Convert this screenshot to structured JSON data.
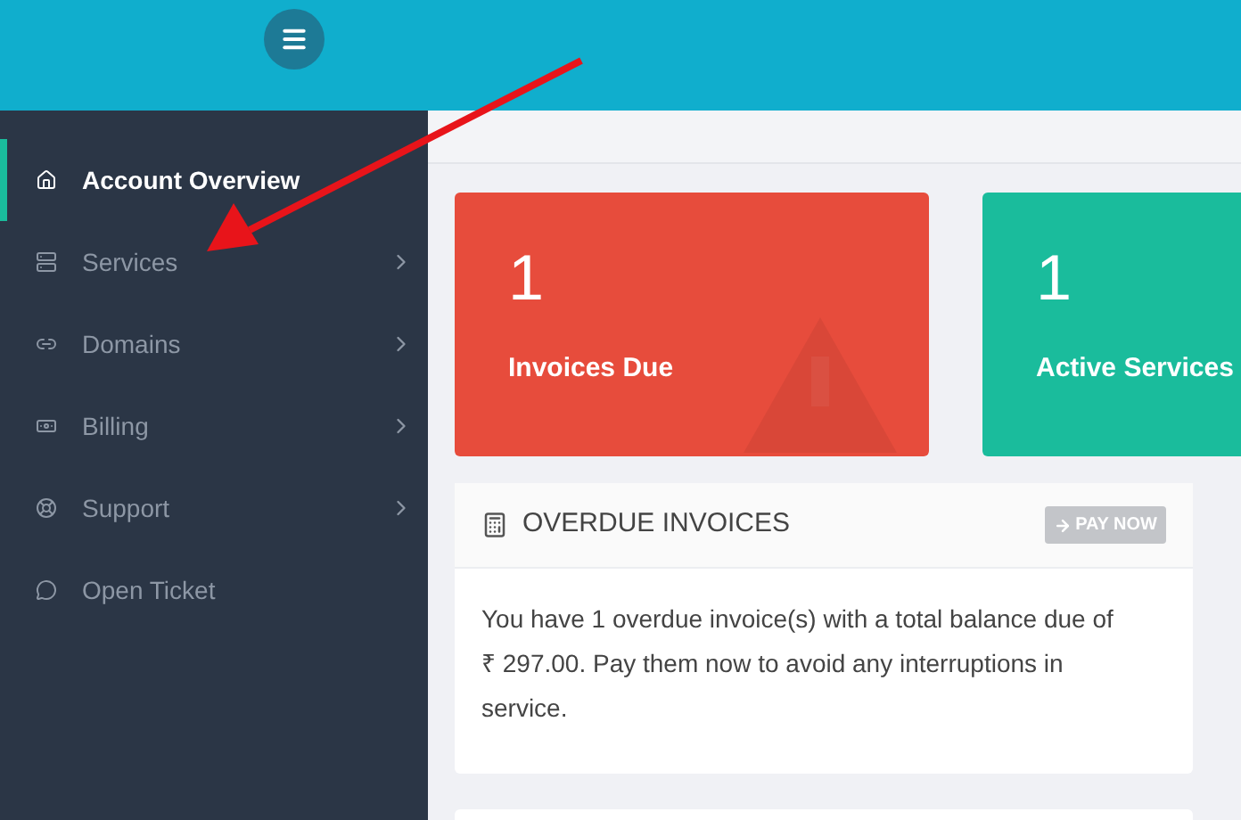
{
  "sidebar": {
    "items": [
      {
        "label": "Account Overview",
        "selected": true,
        "has_submenu": false
      },
      {
        "label": "Services",
        "selected": false,
        "has_submenu": true
      },
      {
        "label": "Domains",
        "selected": false,
        "has_submenu": true
      },
      {
        "label": "Billing",
        "selected": false,
        "has_submenu": true
      },
      {
        "label": "Support",
        "selected": false,
        "has_submenu": true
      },
      {
        "label": "Open Ticket",
        "selected": false,
        "has_submenu": false
      }
    ]
  },
  "stats": [
    {
      "count": "1",
      "label": "Invoices Due",
      "color": "#e74c3c"
    },
    {
      "count": "1",
      "label": "Active Services",
      "color": "#1abc9c"
    }
  ],
  "overdue_panel": {
    "title": "OVERDUE INVOICES",
    "button": "PAY NOW",
    "message": "You have 1 overdue invoice(s) with a total balance due of ₹ 297.00. Pay them now to avoid any interruptions in service."
  }
}
